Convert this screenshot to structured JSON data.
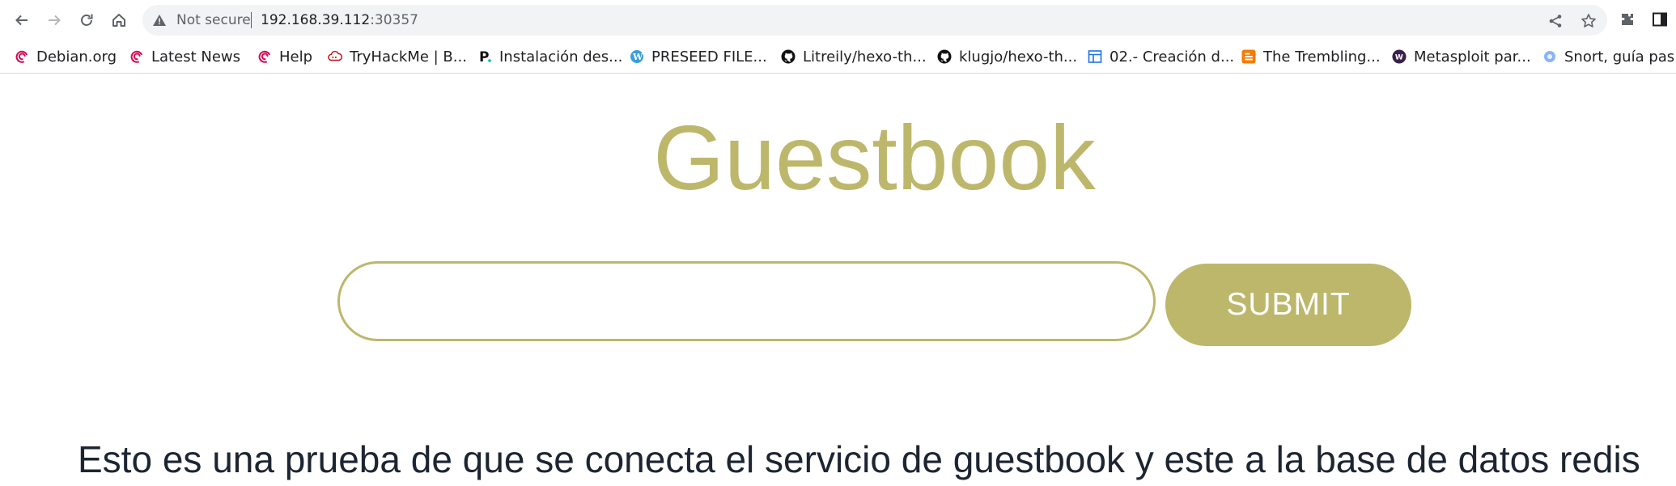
{
  "browser": {
    "security_label": "Not secure",
    "url_host": "192.168.39.112",
    "url_port": ":30357",
    "nav_icons": [
      "back-arrow-icon",
      "forward-arrow-icon",
      "reload-icon",
      "home-icon"
    ],
    "right_icons": [
      "share-icon",
      "star-icon",
      "extensions-icon",
      "side-panel-icon"
    ]
  },
  "bookmarks": [
    {
      "label": "Debian.org",
      "icon": "debian-swirl-icon"
    },
    {
      "label": "Latest News",
      "icon": "debian-swirl-icon"
    },
    {
      "label": "Help",
      "icon": "debian-swirl-icon"
    },
    {
      "label": "TryHackMe | B...",
      "icon": "tryhackme-cloud-icon"
    },
    {
      "label": "Instalación des...",
      "icon": "p-letter-icon"
    },
    {
      "label": "PRESEED FILE...",
      "icon": "wordpress-icon"
    },
    {
      "label": "Litreily/hexo-th...",
      "icon": "github-icon"
    },
    {
      "label": "klugjo/hexo-th...",
      "icon": "github-icon"
    },
    {
      "label": "02.- Creación d...",
      "icon": "layout-icon"
    },
    {
      "label": "The Trembling...",
      "icon": "blogger-icon"
    },
    {
      "label": "Metasploit par...",
      "icon": "w-circle-icon"
    },
    {
      "label": "Snort, guía pas...",
      "icon": "blue-circle-icon"
    }
  ],
  "colors": {
    "accent": "#bdb76b",
    "entry_text": "#1d2532"
  },
  "guestbook": {
    "title": "Guestbook",
    "input_value": "",
    "submit_label": "SUBMIT",
    "entries": [
      "Esto es una prueba de que se conecta el servicio de guestbook y este a la base de datos redis"
    ]
  }
}
